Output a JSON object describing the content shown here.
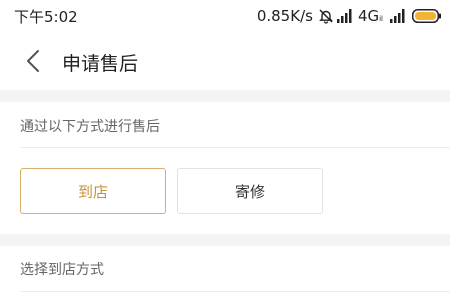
{
  "status_bar": {
    "time": "下午5:02",
    "speed": "0.85K/s",
    "network": "4G",
    "network_sub": "il",
    "icons": [
      "bell-muted-icon",
      "signal-icon",
      "signal-icon",
      "battery-icon"
    ]
  },
  "header": {
    "title": "申请售后",
    "back_icon": "chevron-left-icon"
  },
  "service_method": {
    "label": "通过以下方式进行售后",
    "options": [
      {
        "label": "到店",
        "selected": true
      },
      {
        "label": "寄修",
        "selected": false
      }
    ]
  },
  "store_method": {
    "label": "选择到店方式"
  },
  "colors": {
    "accent": "#c9913b",
    "accent_border": "#d9ad6c",
    "battery": "#f2b233",
    "separator": "#f4f4f4"
  }
}
